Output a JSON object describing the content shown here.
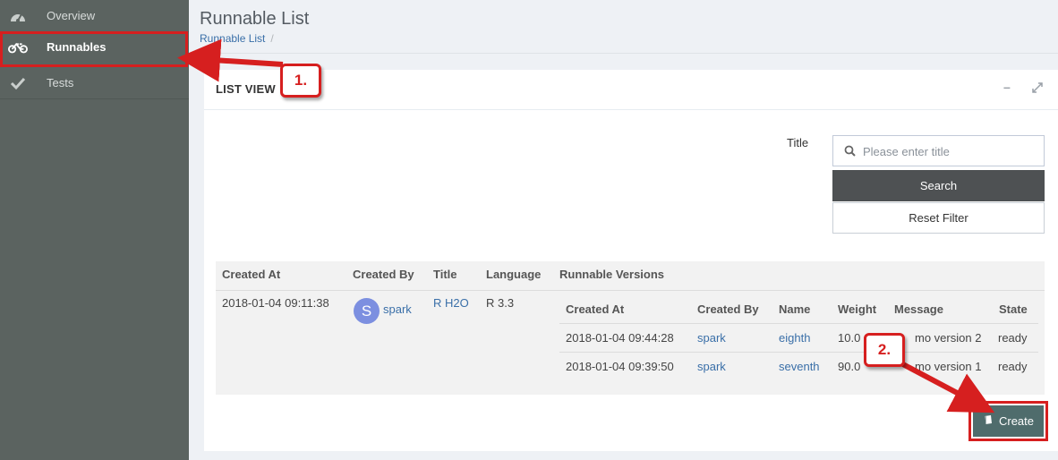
{
  "sidebar": {
    "items": [
      {
        "label": "Overview",
        "icon": "dashboard-icon"
      },
      {
        "label": "Runnables",
        "icon": "bicycle-icon"
      },
      {
        "label": "Tests",
        "icon": "checkmark-icon"
      }
    ]
  },
  "header": {
    "title": "Runnable List",
    "breadcrumb": "Runnable List",
    "breadcrumb_sep": "/"
  },
  "panel": {
    "title": "LIST VIEW",
    "minimize": "–"
  },
  "filter": {
    "title_label": "Title",
    "search_placeholder": "Please enter title",
    "search_button": "Search",
    "reset_button": "Reset Filter"
  },
  "table": {
    "headers": [
      "Created At",
      "Created By",
      "Title",
      "Language",
      "Runnable Versions"
    ],
    "row": {
      "created_at": "2018-01-04 09:11:38",
      "avatar": "S",
      "created_by": "spark",
      "title": "R H2O",
      "language": "R 3.3"
    }
  },
  "versions": {
    "headers": [
      "Created At",
      "Created By",
      "Name",
      "Weight",
      "Message",
      "State"
    ],
    "rows": [
      {
        "created_at": "2018-01-04 09:44:28",
        "created_by": "spark",
        "name": "eighth",
        "weight": "10.0",
        "message": "mo version 2",
        "state": "ready"
      },
      {
        "created_at": "2018-01-04 09:39:50",
        "created_by": "spark",
        "name": "seventh",
        "weight": "90.0",
        "message": "mo version 1",
        "state": "ready"
      }
    ]
  },
  "create_button": "Create",
  "annotations": {
    "step1": "1.",
    "step2": "2."
  },
  "colors": {
    "sidebar": "#5b6360",
    "accent_link": "#3a6fa8",
    "highlight_red": "#d61f1f",
    "create_button": "#4f6c6c"
  }
}
